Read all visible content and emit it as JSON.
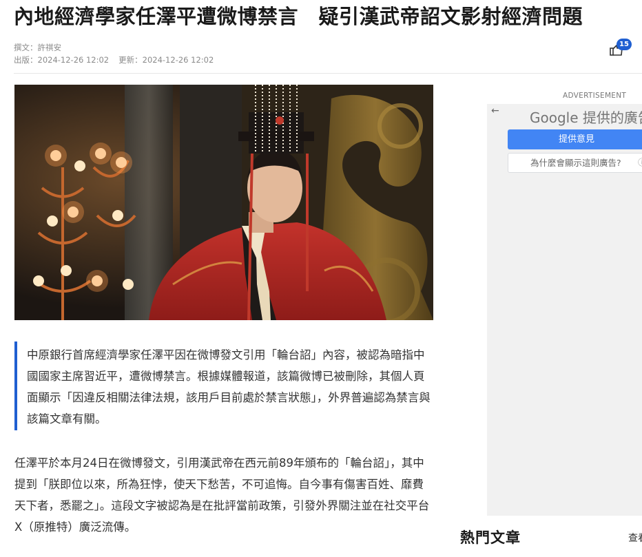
{
  "article": {
    "headline": "內地經濟學家任澤平遭微博禁言　疑引漢武帝詔文影射經濟問題",
    "author_line": "撰文：許祺安",
    "published_line": "出版：2024-12-26 12:02",
    "updated_line": "更新：2024-12-26 12:02",
    "lead": "中原銀行首席經濟學家任澤平因在微博發文引用「輪台詔」內容，被認為暗指中國國家主席習近平，遭微博禁言。根據媒體報道，該篇微博已被刪除，其個人頁面顯示「因違反相關法律法規，該用戶目前處於禁言狀態」，外界普遍認為禁言與該篇文章有關。",
    "body": "任澤平於本月24日在微博發文，引用漢武帝在西元前89年頒布的「輪台詔」，其中提到「朕即位以來，所為狂悖，使天下愁苦，不可追悔。自今事有傷害百姓、靡費天下者，悉罷之」。這段文字被認為是在批評當前政策，引發外界關注並在社交平台X（原推特）廣泛流傳。"
  },
  "share": {
    "count": "15",
    "icon": "share-icon"
  },
  "hero_image": {
    "icon": "photo"
  },
  "ad": {
    "label": "ADVERTISEMENT",
    "provider": "Google 提供的廣告",
    "feedback_button": "提供意見",
    "why_button": "為什麼會顯示這則廣告?",
    "back_icon": "←",
    "info_icon": "ⓘ"
  },
  "sidebar": {
    "hot_title": "熱門文章",
    "more_link": "查看"
  },
  "colors": {
    "accent": "#1f5fd1",
    "google_blue": "#4285f4"
  }
}
